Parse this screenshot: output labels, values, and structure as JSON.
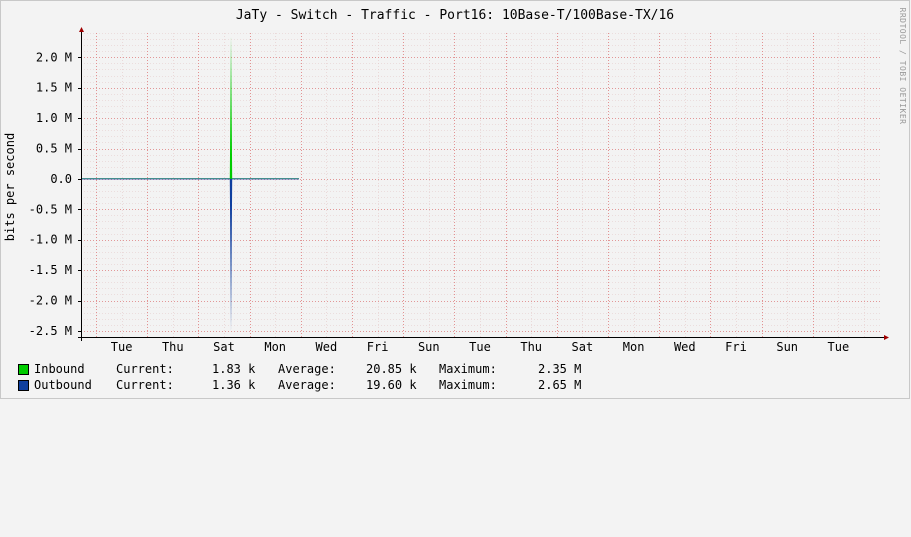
{
  "watermark": "RRDTOOL / TOBI OETIKER",
  "chart_data": {
    "type": "area",
    "title": "JaTy - Switch - Traffic - Port16: 10Base-T/100Base-TX/16",
    "ylabel": "bits per second",
    "ylim": [
      -2.6,
      2.4
    ],
    "y_ticks": [
      2.0,
      1.5,
      1.0,
      0.5,
      0.0,
      -0.5,
      -1.0,
      -1.5,
      -2.0,
      -2.5
    ],
    "y_tick_labels": [
      "2.0 M",
      "1.5 M",
      "1.0 M",
      "0.5 M",
      "0.0",
      "-0.5 M",
      "-1.0 M",
      "-1.5 M",
      "-2.0 M",
      "-2.5 M"
    ],
    "x_tick_labels": [
      "Tue",
      "Thu",
      "Sat",
      "Mon",
      "Wed",
      "Fri",
      "Sun",
      "Tue",
      "Thu",
      "Sat",
      "Mon",
      "Wed",
      "Fri",
      "Sun",
      "Tue"
    ],
    "grid": true,
    "series": [
      {
        "name": "Inbound",
        "color": "#00cc00",
        "spike_at": 2.07,
        "peak": 2.35,
        "data_end": 4.3
      },
      {
        "name": "Outbound",
        "color": "#0f3f9f",
        "spike_at": 2.07,
        "peak": -2.65,
        "data_end": 4.3
      }
    ],
    "legend": [
      {
        "name": "Inbound",
        "color": "#00cc00",
        "current_label": "Current:",
        "current": "1.83 k",
        "average_label": "Average:",
        "average": "20.85 k",
        "maximum_label": "Maximum:",
        "maximum": "2.35 M"
      },
      {
        "name": "Outbound",
        "color": "#0f3f9f",
        "current_label": "Current:",
        "current": "1.36 k",
        "average_label": "Average:",
        "average": "19.60 k",
        "maximum_label": "Maximum:",
        "maximum": "2.65 M"
      }
    ]
  }
}
